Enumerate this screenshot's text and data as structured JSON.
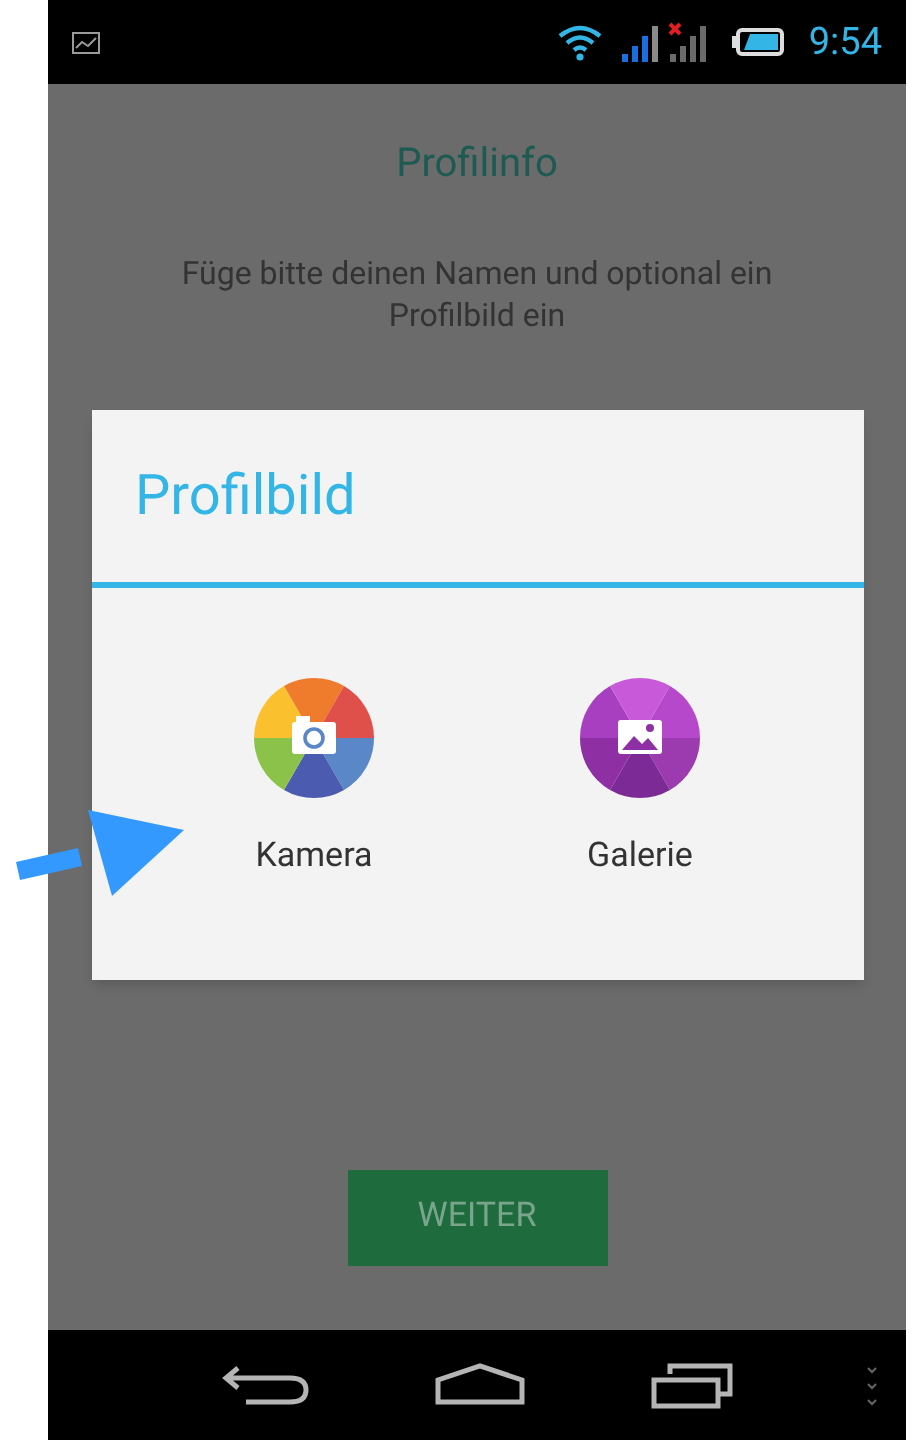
{
  "status_bar": {
    "time": "9:54"
  },
  "screen": {
    "title": "Profilinfo",
    "instruction": "Füge bitte deinen Namen und optional ein Profilbild ein",
    "button": "WEITER"
  },
  "dialog": {
    "title": "Profilbild",
    "options": [
      {
        "kind": "camera",
        "label": "Kamera"
      },
      {
        "kind": "gallery",
        "label": "Galerie"
      }
    ]
  }
}
